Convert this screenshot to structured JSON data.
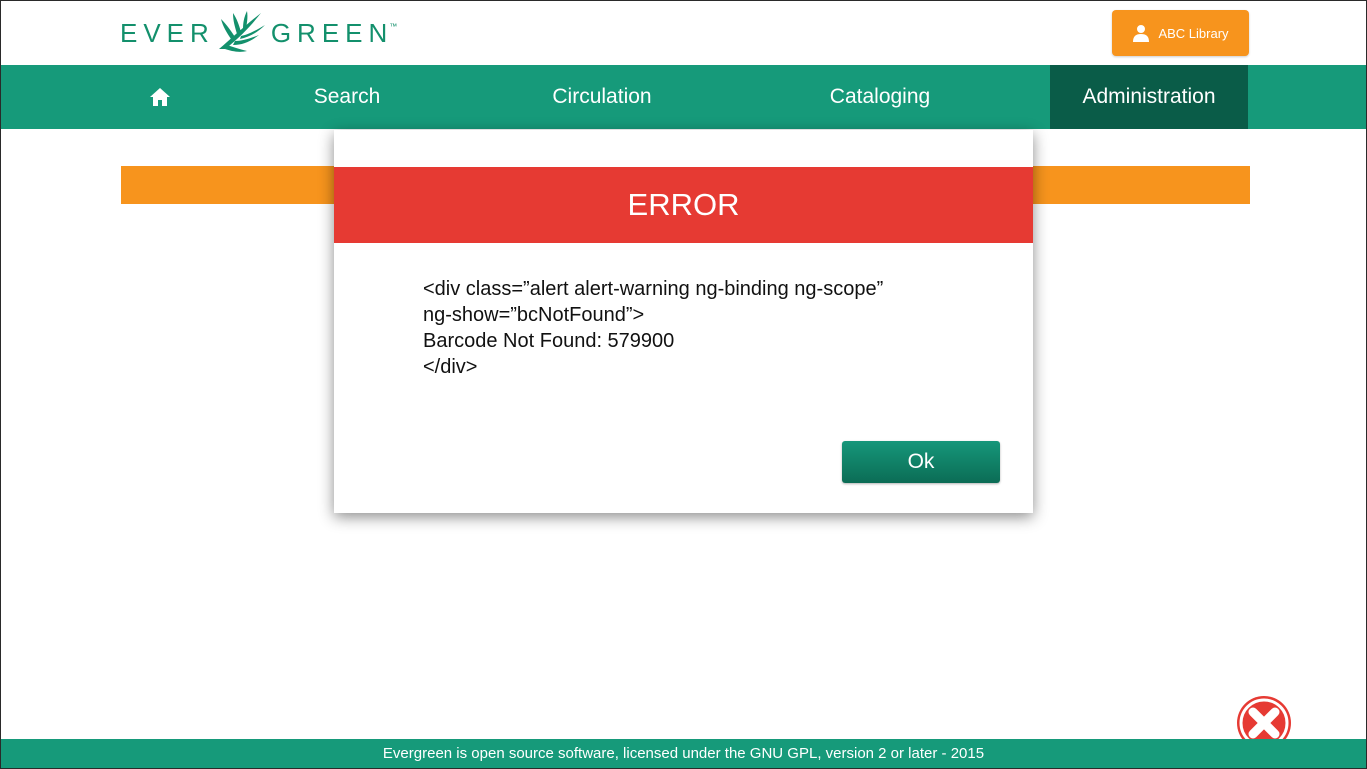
{
  "header": {
    "logo": {
      "left": "EVER",
      "right": "GREEN",
      "tm": "™"
    },
    "user_button": {
      "label": "ABC Library",
      "icon": "user-icon"
    }
  },
  "nav": {
    "home_icon": "home-icon",
    "items": [
      {
        "label": "Search"
      },
      {
        "label": "Circulation"
      },
      {
        "label": "Cataloging"
      },
      {
        "label": "Administration",
        "active": true
      }
    ]
  },
  "dialog": {
    "title": "ERROR",
    "body_lines": [
      "<div class=”alert alert-warning ng-binding ng-scope”",
      "ng-show=”bcNotFound”>",
      "Barcode Not Found: 579900",
      "</div>"
    ],
    "ok_label": "Ok"
  },
  "close_icon": "close-circle-icon",
  "footer": {
    "text": "Evergreen is open source software, licensed under the GNU GPL, version 2 or later - 2015"
  },
  "colors": {
    "brand_green": "#169a7a",
    "active_nav": "#0a5c48",
    "accent_orange": "#f7941d",
    "error_red": "#e63a33"
  }
}
